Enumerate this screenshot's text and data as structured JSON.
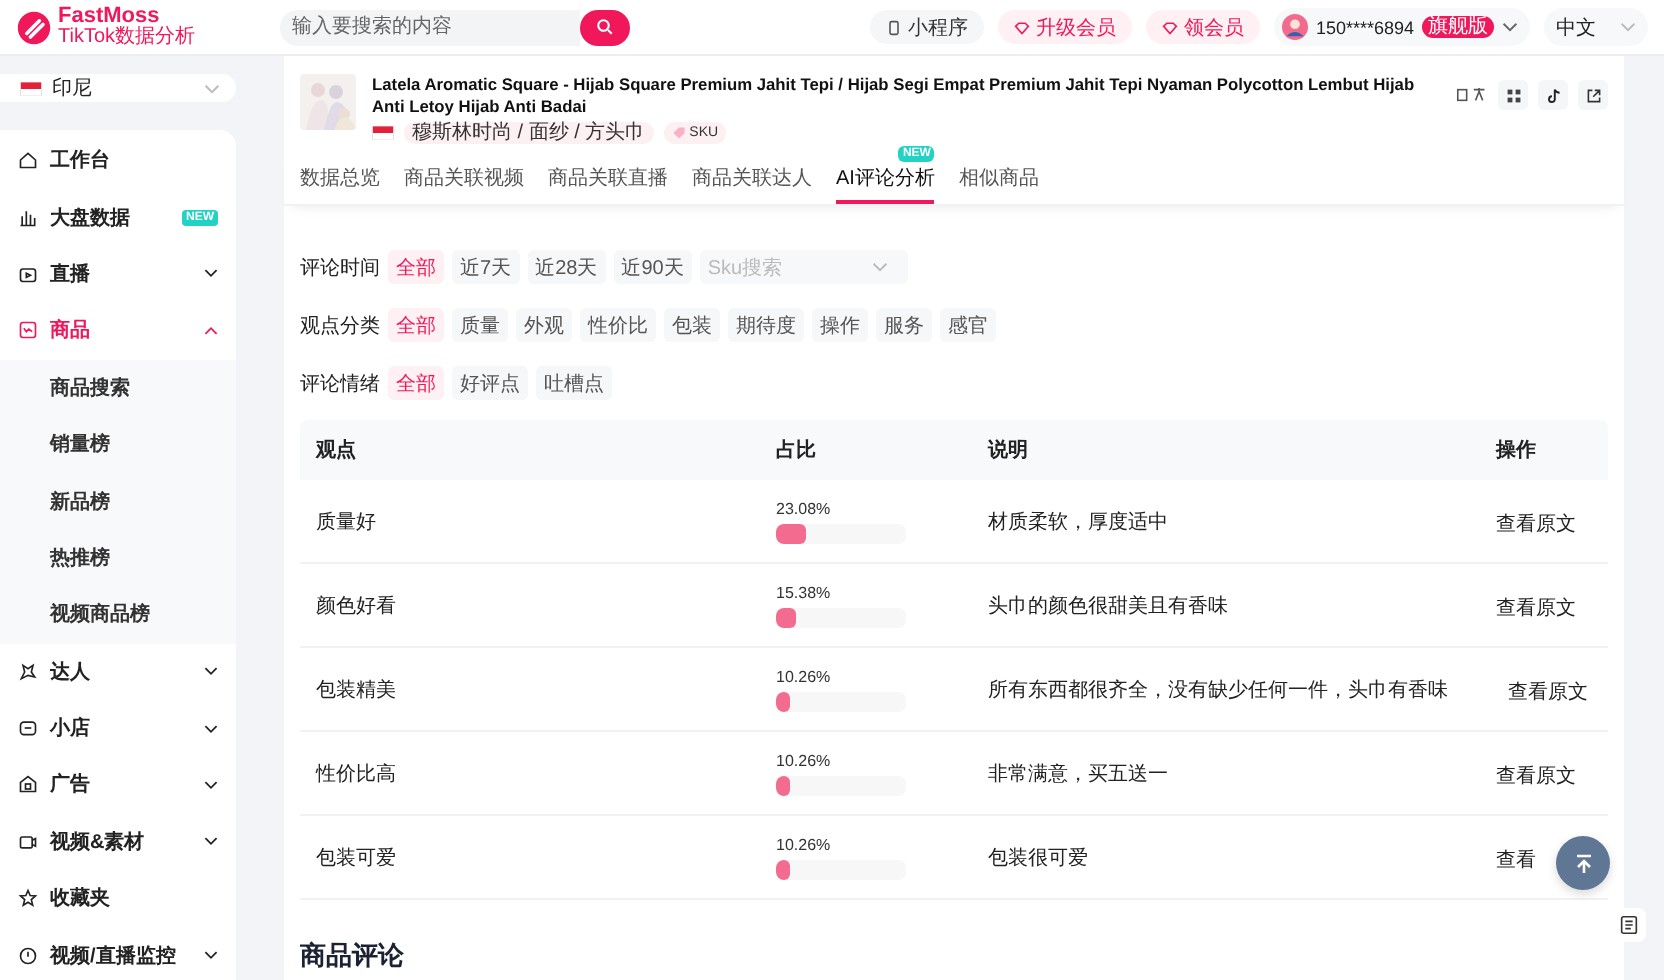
{
  "header": {
    "logo": "FastMoss",
    "logo_subtitle": "TikTok数据分析",
    "search": {
      "placeholder": "输入要搜索的内容"
    },
    "buttons": [
      {
        "label": "小程序",
        "kind": "plain"
      },
      {
        "label": "升级会员",
        "kind": "promo"
      },
      {
        "label": "领会员",
        "kind": "promo"
      }
    ],
    "account": {
      "phone": "150****6894",
      "badge": "旗舰版"
    },
    "language": "中文"
  },
  "sidebar": {
    "country": "印尼",
    "items": [
      {
        "label": "工作台",
        "kind": "link",
        "selected": false
      },
      {
        "label": "大盘数据",
        "kind": "link",
        "selected": false,
        "badge": "NEW"
      },
      {
        "label": "直播",
        "kind": "group",
        "selected": false,
        "expanded": false
      },
      {
        "label": "商品",
        "kind": "group",
        "selected": true,
        "expanded": true,
        "children": [
          {
            "label": "商品搜索"
          },
          {
            "label": "销量榜"
          },
          {
            "label": "新品榜"
          },
          {
            "label": "热推榜"
          },
          {
            "label": "视频商品榜"
          }
        ]
      },
      {
        "label": "达人",
        "kind": "group",
        "selected": false,
        "expanded": false
      },
      {
        "label": "小店",
        "kind": "group",
        "selected": false,
        "expanded": false
      },
      {
        "label": "广告",
        "kind": "group",
        "selected": false,
        "expanded": false
      },
      {
        "label": "视频&素材",
        "kind": "group",
        "selected": false,
        "expanded": false
      },
      {
        "label": "收藏夹",
        "kind": "link",
        "selected": false
      },
      {
        "label": "视频/直播监控",
        "kind": "group",
        "selected": false,
        "expanded": false
      }
    ]
  },
  "product": {
    "title": "Latela Aromatic Square - Hijab Square Premium Jahit Tepi / Hijab Segi Empat Premium Jahit Tepi Nyaman Polycotton Lembut Hijab Anti Letoy Hijab Anti Badai",
    "category": "穆斯林时尚 / 面纱 / 方头巾",
    "sku": "SKU",
    "tabs": [
      {
        "label": "数据总览",
        "selected": false
      },
      {
        "label": "商品关联视频",
        "selected": false
      },
      {
        "label": "商品关联直播",
        "selected": false
      },
      {
        "label": "商品关联达人",
        "selected": false
      },
      {
        "label": "AI评论分析",
        "selected": true,
        "badge": "NEW"
      },
      {
        "label": "相似商品",
        "selected": false
      }
    ]
  },
  "filters": [
    {
      "label": "评论时间",
      "options": [
        {
          "label": "全部",
          "selected": true
        },
        {
          "label": "近7天",
          "selected": false
        },
        {
          "label": "近28天",
          "selected": false
        },
        {
          "label": "近90天",
          "selected": false
        }
      ],
      "select": {
        "placeholder": "Sku搜索"
      }
    },
    {
      "label": "观点分类",
      "options": [
        {
          "label": "全部",
          "selected": true
        },
        {
          "label": "质量",
          "selected": false
        },
        {
          "label": "外观",
          "selected": false
        },
        {
          "label": "性价比",
          "selected": false
        },
        {
          "label": "包装",
          "selected": false
        },
        {
          "label": "期待度",
          "selected": false
        },
        {
          "label": "操作",
          "selected": false
        },
        {
          "label": "服务",
          "selected": false
        },
        {
          "label": "感官",
          "selected": false
        }
      ]
    },
    {
      "label": "评论情绪",
      "options": [
        {
          "label": "全部",
          "selected": true
        },
        {
          "label": "好评点",
          "selected": false
        },
        {
          "label": "吐槽点",
          "selected": false
        }
      ]
    }
  ],
  "table": {
    "columns": [
      "观点",
      "占比",
      "说明",
      "操作"
    ],
    "rows": [
      {
        "viewpoint": "质量好",
        "share": "23.08%",
        "level": 0.2308,
        "description": "材质柔软，厚度适中",
        "action": "查看原文"
      },
      {
        "viewpoint": "颜色好看",
        "share": "15.38%",
        "level": 0.1538,
        "description": "头巾的颜色很甜美且有香味",
        "action": "查看原文"
      },
      {
        "viewpoint": "包装精美",
        "share": "10.26%",
        "level": 0.1026,
        "description": "所有东西都很齐全，没有缺少任何一件，头巾有香味",
        "action": "查看原文"
      },
      {
        "viewpoint": "性价比高",
        "share": "10.26%",
        "level": 0.1026,
        "description": "非常满意，买五送一",
        "action": "查看原文"
      },
      {
        "viewpoint": "包装可爱",
        "share": "10.26%",
        "level": 0.1026,
        "description": "包装很可爱",
        "action": "查看"
      }
    ]
  },
  "section_title": "商品评论"
}
